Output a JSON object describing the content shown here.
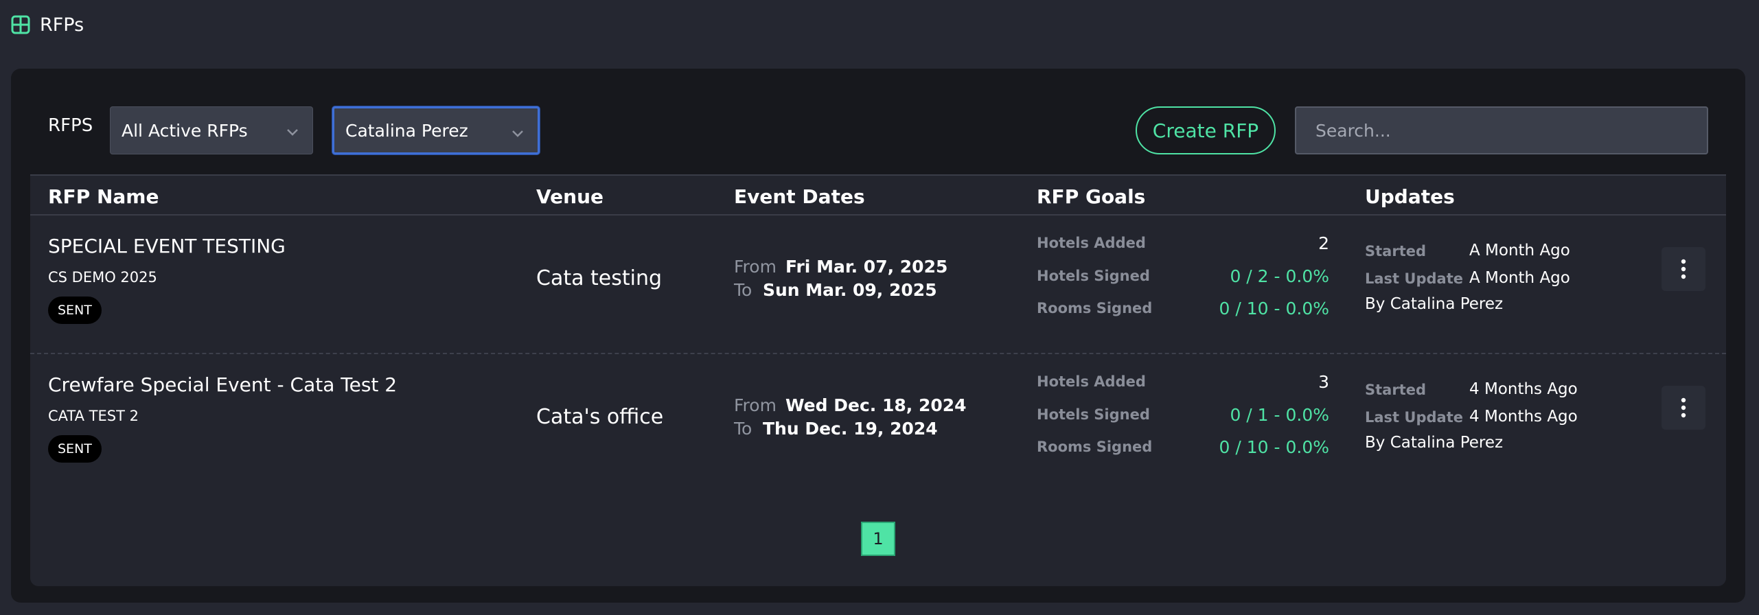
{
  "page": {
    "title": "RFPs",
    "icon": "grid-icon"
  },
  "toolbar": {
    "label": "RFPS",
    "status_filter": "All Active RFPs",
    "owner_filter": "Catalina Perez",
    "create_label": "Create RFP",
    "search_placeholder": "Search..."
  },
  "table": {
    "headers": {
      "name": "RFP Name",
      "venue": "Venue",
      "dates": "Event Dates",
      "goals": "RFP Goals",
      "updates": "Updates"
    },
    "rows": [
      {
        "name": "SPECIAL EVENT TESTING",
        "code": "CS DEMO 2025",
        "status": "SENT",
        "venue": "Cata testing",
        "from_label": "From",
        "from": "Fri Mar. 07, 2025",
        "to_label": "To",
        "to": "Sun Mar. 09, 2025",
        "goals": {
          "hotels_added_label": "Hotels Added",
          "hotels_added": "2",
          "hotels_signed_label": "Hotels Signed",
          "hotels_signed": "0 / 2 - 0.0%",
          "rooms_signed_label": "Rooms Signed",
          "rooms_signed": "0 / 10 - 0.0%"
        },
        "updates": {
          "started_label": "Started",
          "started": "A Month Ago",
          "last_update_label": "Last Update",
          "last_update": "A Month Ago",
          "by": "By Catalina Perez"
        }
      },
      {
        "name": "Crewfare Special Event - Cata Test 2",
        "code": "CATA TEST 2",
        "status": "SENT",
        "venue": "Cata's office",
        "from_label": "From",
        "from": "Wed Dec. 18, 2024",
        "to_label": "To",
        "to": "Thu Dec. 19, 2024",
        "goals": {
          "hotels_added_label": "Hotels Added",
          "hotels_added": "3",
          "hotels_signed_label": "Hotels Signed",
          "hotels_signed": "0 / 1 - 0.0%",
          "rooms_signed_label": "Rooms Signed",
          "rooms_signed": "0 / 10 - 0.0%"
        },
        "updates": {
          "started_label": "Started",
          "started": "4 Months Ago",
          "last_update_label": "Last Update",
          "last_update": "4 Months Ago",
          "by": "By Catalina Perez"
        }
      }
    ]
  },
  "pagination": {
    "current": "1"
  },
  "colors": {
    "accent": "#4fe3a5",
    "background": "#252731",
    "panel": "#17181d",
    "focus": "#3f6fd6"
  }
}
